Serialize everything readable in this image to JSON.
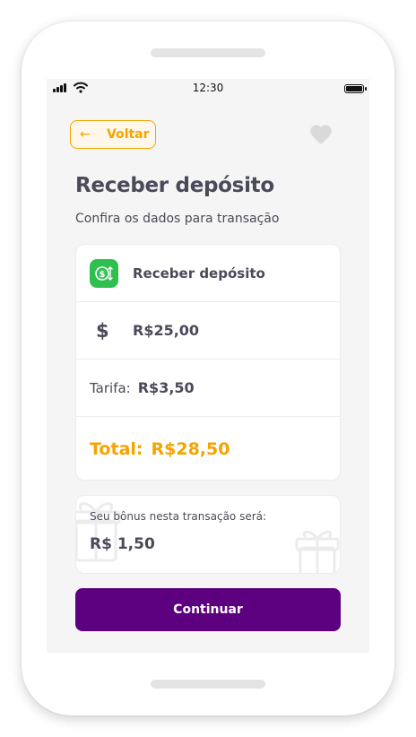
{
  "status_bar": {
    "time": "12:30"
  },
  "header": {
    "back_label": "Voltar",
    "back_icon": "arrow-left-icon",
    "favorite_icon": "heart-icon"
  },
  "page": {
    "title": "Receber depósito",
    "subtitle": "Confira os dados para transação"
  },
  "summary": {
    "operation_icon": "deposit-exchange-icon",
    "operation": "Receber depósito",
    "currency_icon": "dollar-icon",
    "amount": "R$25,00",
    "fee_label": "Tarifa:",
    "fee_value": "R$3,50",
    "total_label": "Total:",
    "total_value": "R$28,50"
  },
  "bonus": {
    "text": "Seu bônus nesta transação será:",
    "value": "R$ 1,50",
    "decor_icon": "gift-icon"
  },
  "actions": {
    "continue_label": "Continuar"
  },
  "colors": {
    "accent": "#f5a300",
    "primary": "#5c007f",
    "success": "#2fbf4f",
    "text": "#4a4a5a",
    "background": "#f5f5f5"
  }
}
